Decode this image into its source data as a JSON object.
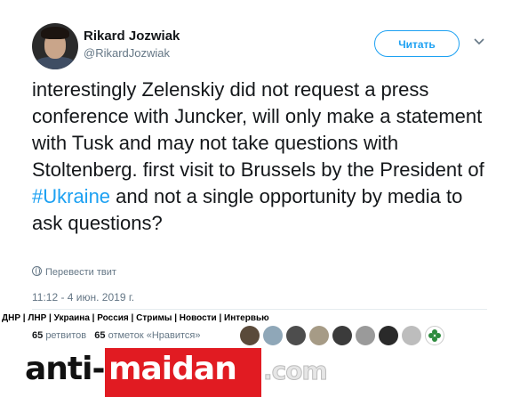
{
  "tweet": {
    "author_name": "Rikard Jozwiak",
    "author_handle": "@RikardJozwiak",
    "follow_label": "Читать",
    "text_before": "interestingly Zelenskiy did not request a press conference with Juncker, will only make a statement with Tusk and may not take questions with Stoltenberg. first visit to Brussels by the President of ",
    "hashtag": "#Ukraine",
    "text_after": " and not a single opportunity by media to ask questions?",
    "translate_label": "Перевести твит",
    "timestamp": "11:12 - 4 июн. 2019 г.",
    "retweets_count": "65",
    "retweets_label": "ретвитов",
    "likes_count": "65",
    "likes_label": "отметок «Нравится»"
  },
  "site": {
    "nav_line": "ДНР | ЛНР | Украина | Россия | Стримы | Новости | Интервью",
    "logo_anti": "anti-",
    "logo_maidan": "maidan",
    "logo_com": ".com"
  },
  "icons": {
    "chevron": "chevron-down-icon",
    "globe": "globe-icon"
  },
  "colors": {
    "accent": "#1da1f2",
    "text": "#14171a",
    "muted": "#657786",
    "logo_red": "#e11b22"
  }
}
